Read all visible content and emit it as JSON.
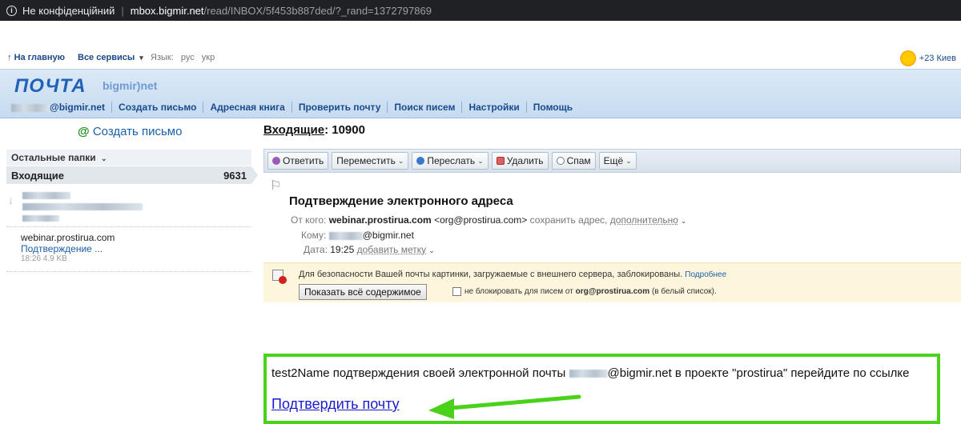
{
  "browser": {
    "security": "Не конфіденційний",
    "host": "mbox.bigmir.net",
    "path": "/read/INBOX/5f453b887ded/?_rand=1372797869"
  },
  "topnav": {
    "home": "На главную",
    "services": "Все сервисы",
    "lang_label": "Язык:",
    "lang_ru": "рус",
    "lang_uk": "укр",
    "weather": "+23 Киев"
  },
  "header": {
    "logo": "ПОЧТА",
    "logo_sub": "bigmir)net",
    "account_suffix": "@bigmir.net",
    "menu": [
      "Создать письмо",
      "Адресная книга",
      "Проверить почту",
      "Поиск писем",
      "Настройки",
      "Помощь"
    ]
  },
  "sidebar": {
    "compose": "Создать письмо",
    "folders_header": "Остальные папки",
    "inbox_label": "Входящие",
    "inbox_count": "9631",
    "message": {
      "from": "webinar.prostirua.com",
      "subject": "Подтверждение ...",
      "meta": "18:26 4.9 KB"
    }
  },
  "main": {
    "title_prefix": "Входящие",
    "title_count": ": 10900",
    "toolbar": {
      "reply": "Ответить",
      "move": "Переместить",
      "forward": "Переслать",
      "delete": "Удалить",
      "spam": "Спам",
      "more": "Ещё"
    },
    "subject": "Подтверждение электронного адреса",
    "from_label": "От кого:",
    "from_name": "webinar.prostirua.com",
    "from_email": "<org@prostirua.com>",
    "save_address": "сохранить адрес,",
    "more_link": "дополнительно",
    "to_label": "Кому:",
    "to_suffix": "@bigmir.net",
    "date_label": "Дата:",
    "date_value": "19:25",
    "add_label": "добавить метку",
    "warning": "Для безопасности Вашей почты картинки, загружаемые с внешнего сервера, заблокированы.",
    "warning_more": "Подробнее",
    "show_all": "Показать всё содержимое",
    "no_block_prefix": "не блокировать для писем от",
    "no_block_email": "org@prostirua.com",
    "no_block_suffix": "(в белый список).",
    "body_prefix": "test2Name подтверждения своей электронной почты",
    "body_suffix": "@bigmir.net в проекте \"prostirua\" перейдите по ссылке",
    "confirm_link": "Подтвердить почту"
  },
  "colors": {
    "highlight_border": "#4ad21a",
    "link": "#1a1ad0",
    "brand": "#1e63b5"
  }
}
